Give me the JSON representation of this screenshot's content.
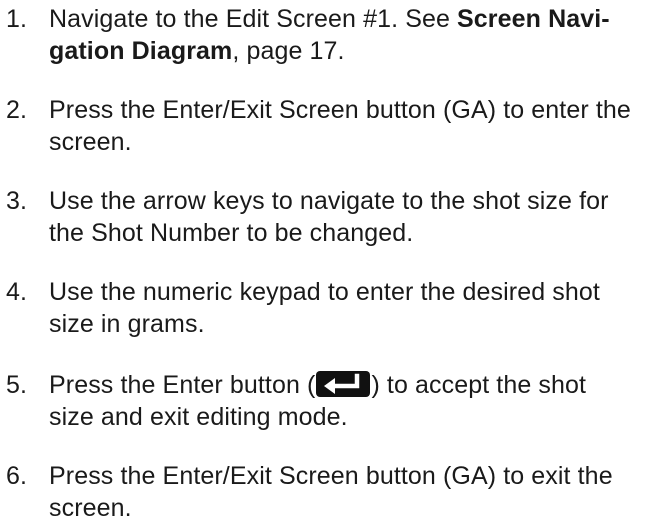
{
  "steps": [
    {
      "number": "1.",
      "line1_a": "Navigate to the Edit Screen #1. See ",
      "line1_b": "Screen Navi-",
      "line2_a": "gation Diagram",
      "line2_b": ", page 17."
    },
    {
      "number": "2.",
      "line1": "Press the Enter/Exit Screen button (GA) to enter the",
      "line2": "screen."
    },
    {
      "number": "3.",
      "line1": "Use the arrow keys to navigate to the shot size for",
      "line2": "the Shot Number to be changed."
    },
    {
      "number": "4.",
      "line1": "Use the numeric keypad to enter the desired shot",
      "line2": "size in grams."
    },
    {
      "number": "5.",
      "line1_a": "Press the Enter button (",
      "icon": "enter-key-icon",
      "line1_b": ") to accept the shot",
      "line2": "size and exit editing mode."
    },
    {
      "number": "6.",
      "line1": "Press the Enter/Exit Screen button (GA) to exit the",
      "line2": "screen."
    }
  ],
  "colors": {
    "text": "#1a1a1a",
    "icon_bg": "#111111",
    "icon_fg": "#ffffff"
  }
}
